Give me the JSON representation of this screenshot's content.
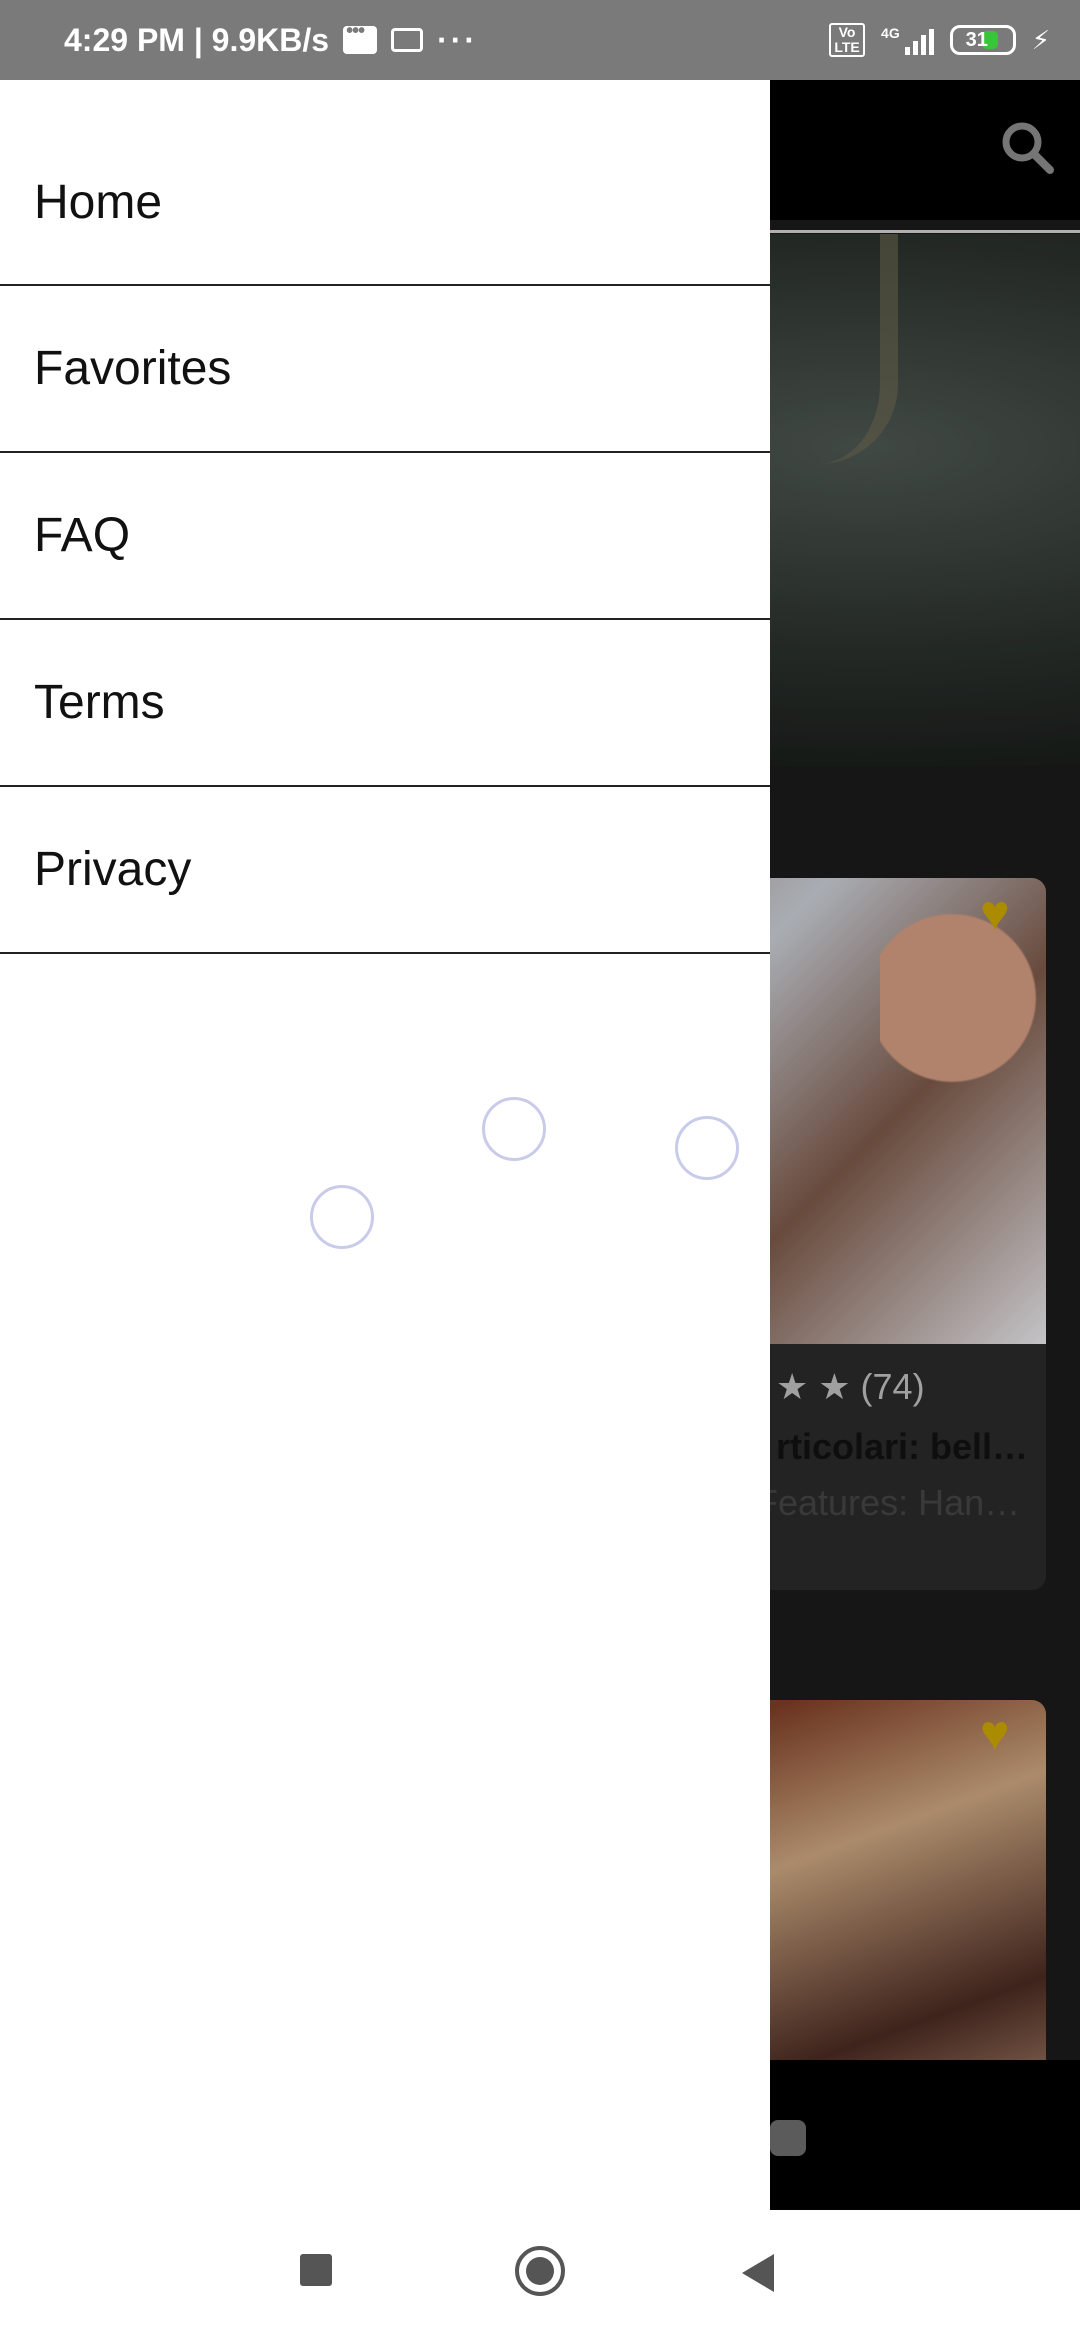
{
  "status_bar": {
    "time_speed": "4:29 PM | 9.9KB/s",
    "volte": "Vo LTE",
    "network": "4G",
    "battery": "31"
  },
  "drawer": {
    "items": [
      {
        "label": "Home"
      },
      {
        "label": "Favorites"
      },
      {
        "label": "FAQ"
      },
      {
        "label": "Terms"
      },
      {
        "label": "Privacy"
      }
    ]
  },
  "background": {
    "card1": {
      "rating_count": "★ ★ (74)",
      "title": "rticolari: bell…",
      "subtitle": "Features: Han…"
    }
  },
  "colors": {
    "drawer_bg": "#ffffff",
    "heart": "#c9a400",
    "status_bar": "#7a7a7a",
    "battery_fill": "#39c53b"
  }
}
